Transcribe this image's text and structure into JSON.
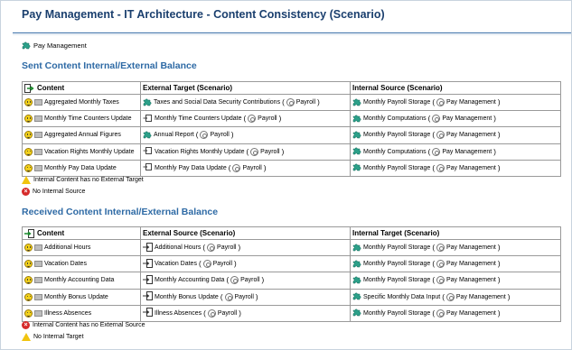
{
  "page": {
    "title": "Pay Management - IT Architecture - Content Consistency (Scenario)",
    "parent_link": "Pay Management"
  },
  "sent": {
    "title": "Sent Content Internal/External Balance",
    "headers": [
      "Content",
      "External Target (Scenario)",
      "Internal Source (Scenario)"
    ],
    "rows": [
      {
        "content": "Aggregated Monthly Taxes",
        "ext_name": "Taxes and Social Data Security Contributions",
        "ext_icon": "puzzle-icon",
        "ext_owner": "Payroll",
        "int_name": "Monthly Payroll Storage",
        "int_icon": "puzzle-icon",
        "int_owner": "Pay Management"
      },
      {
        "content": "Monthly Time Counters Update",
        "ext_name": "Monthly Time Counters Update",
        "ext_icon": "exchange-icon",
        "ext_owner": "Payroll",
        "int_name": "Monthly Computations",
        "int_icon": "puzzle-icon",
        "int_owner": "Pay Management"
      },
      {
        "content": "Aggregated Annual Figures",
        "ext_name": "Annual Report",
        "ext_icon": "puzzle-icon",
        "ext_owner": "Payroll",
        "int_name": "Monthly Payroll Storage",
        "int_icon": "puzzle-icon",
        "int_owner": "Pay Management"
      },
      {
        "content": "Vacation Rights Monthly Update",
        "ext_name": "Vacation Rights Monthly Update",
        "ext_icon": "exchange-icon",
        "ext_owner": "Payroll",
        "int_name": "Monthly Computations",
        "int_icon": "puzzle-icon",
        "int_owner": "Pay Management"
      },
      {
        "content": "Monthly Pay Data Update",
        "ext_name": "Monthly Pay Data Update",
        "ext_icon": "exchange-icon",
        "ext_owner": "Payroll",
        "int_name": "Monthly Payroll Storage",
        "int_icon": "puzzle-icon",
        "int_owner": "Pay Management"
      }
    ],
    "legend": [
      "Internal Content has no External Target",
      "No Internal Source"
    ]
  },
  "received": {
    "title": "Received Content Internal/External Balance",
    "headers": [
      "Content",
      "External Source (Scenario)",
      "Internal Target (Scenario)"
    ],
    "rows": [
      {
        "content": "Additional Hours",
        "ext_name": "Additional Hours",
        "ext_icon": "import-icon",
        "ext_owner": "Payroll",
        "int_name": "Monthly Payroll Storage",
        "int_icon": "puzzle-icon",
        "int_owner": "Pay Management"
      },
      {
        "content": "Vacation Dates",
        "ext_name": "Vacation Dates",
        "ext_icon": "import-icon",
        "ext_owner": "Payroll",
        "int_name": "Monthly Payroll Storage",
        "int_icon": "puzzle-icon",
        "int_owner": "Pay Management"
      },
      {
        "content": "Monthly Accounting Data",
        "ext_name": "Monthly Accounting Data",
        "ext_icon": "import-icon",
        "ext_owner": "Payroll",
        "int_name": "Monthly Payroll Storage",
        "int_icon": "puzzle-icon",
        "int_owner": "Pay Management"
      },
      {
        "content": "Monthly Bonus Update",
        "ext_name": "Monthly Bonus Update",
        "ext_icon": "import-icon",
        "ext_owner": "Payroll",
        "int_name": "Specific Monthly Data Input",
        "int_icon": "puzzle-icon",
        "int_owner": "Pay Management"
      },
      {
        "content": "Illness Absences",
        "ext_name": "Illness Absences",
        "ext_icon": "import-icon",
        "ext_owner": "Payroll",
        "int_name": "Monthly Payroll Storage",
        "int_icon": "puzzle-icon",
        "int_owner": "Pay Management"
      }
    ],
    "legend": [
      "Internal Content has no External Source",
      "No Internal Target"
    ]
  }
}
